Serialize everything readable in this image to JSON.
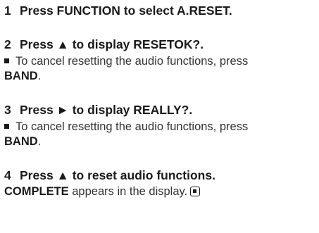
{
  "steps": [
    {
      "number": "1",
      "instruction": "Press FUNCTION to select A.RESET."
    },
    {
      "number": "2",
      "instruction": "Press ▲ to display RESETOK?.",
      "note_text": "To cancel resetting the audio functions, press",
      "note_key": "BAND",
      "note_end": "."
    },
    {
      "number": "3",
      "instruction": "Press ► to display REALLY?.",
      "note_text": "To cancel resetting the audio functions, press",
      "note_key": "BAND",
      "note_end": "."
    },
    {
      "number": "4",
      "instruction": "Press ▲ to reset audio functions.",
      "result_key": "COMPLETE",
      "result_text": " appears in the display.",
      "end_icon": "end-of-section-icon"
    }
  ]
}
